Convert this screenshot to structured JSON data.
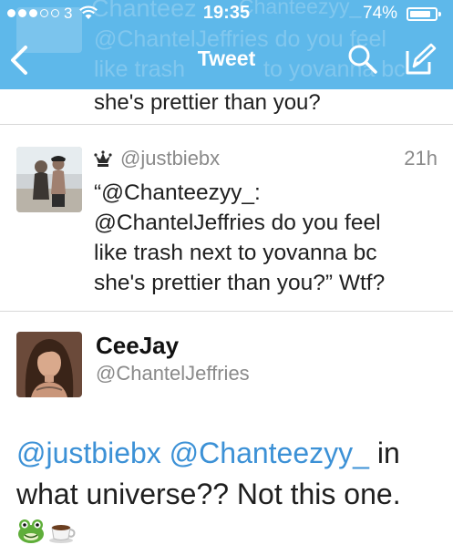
{
  "status_bar": {
    "carrier": "3",
    "time": "19:35",
    "battery": "74%",
    "battery_level": 0.74,
    "signal_bars_filled": 3,
    "signal_bars_total": 5
  },
  "nav": {
    "title": "Tweet",
    "back_icon": "chevron-left-icon",
    "search_icon": "search-icon",
    "compose_icon": "compose-icon"
  },
  "background_ghost_text": {
    "line1": "Chanteez",
    "line1b": "Chanteezyy_",
    "line2": "@ChantelJeffries do you feel",
    "line3": "like trash",
    "line3b": "to yovanna bc"
  },
  "previous_tweet_fragment": "she's prettier than you?",
  "quoted_tweet": {
    "handle": "@justbiebx",
    "time": "21h",
    "badge_icon": "crown-icon",
    "text": "“@Chanteezyy_:\n@ChantelJeffries do you feel\nlike trash next to yovanna bc\nshe's prettier than you?” Wtf?"
  },
  "main_tweet": {
    "name": "CeeJay",
    "handle": "@ChantelJeffries",
    "mention1": "@justbiebx",
    "mention2": "@Chanteezyy_",
    "text_after_mentions": " in what universe?? Not this one.",
    "emojis": [
      "frog-face-icon",
      "coffee-cup-icon"
    ]
  },
  "colors": {
    "nav_bar": "#5eb8ea",
    "mention": "#3c91d6",
    "secondary_text": "#8a8a8a"
  }
}
